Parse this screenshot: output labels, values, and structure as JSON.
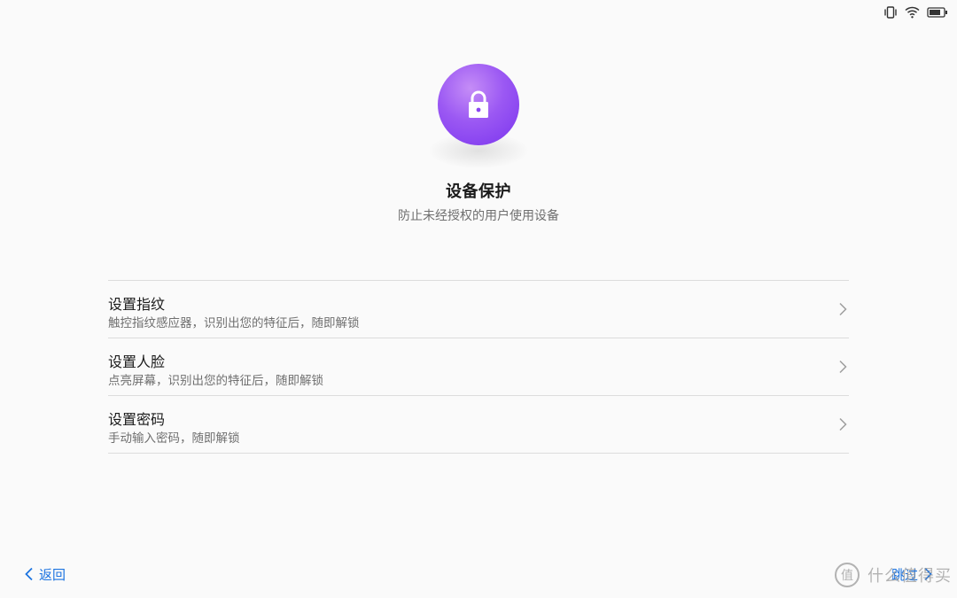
{
  "status_bar": {
    "icons": [
      "vibrate-icon",
      "wifi-icon",
      "battery-icon"
    ]
  },
  "header": {
    "icon": "lock-icon",
    "icon_colors": [
      "#c58df7",
      "#7a34ee"
    ],
    "title": "设备保护",
    "subtitle": "防止未经授权的用户使用设备"
  },
  "options": [
    {
      "title": "设置指纹",
      "description": "触控指纹感应器，识别出您的特征后，随即解锁"
    },
    {
      "title": "设置人脸",
      "description": "点亮屏幕，识别出您的特征后，随即解锁"
    },
    {
      "title": "设置密码",
      "description": "手动输入密码，随即解锁"
    }
  ],
  "nav": {
    "back_label": "返回",
    "skip_label": "跳过"
  },
  "watermark": {
    "text": "什么值得买",
    "glyph": "值"
  },
  "colors": {
    "accent": "#1d74e0",
    "background": "#fafafa",
    "divider": "#dcdcdc"
  }
}
